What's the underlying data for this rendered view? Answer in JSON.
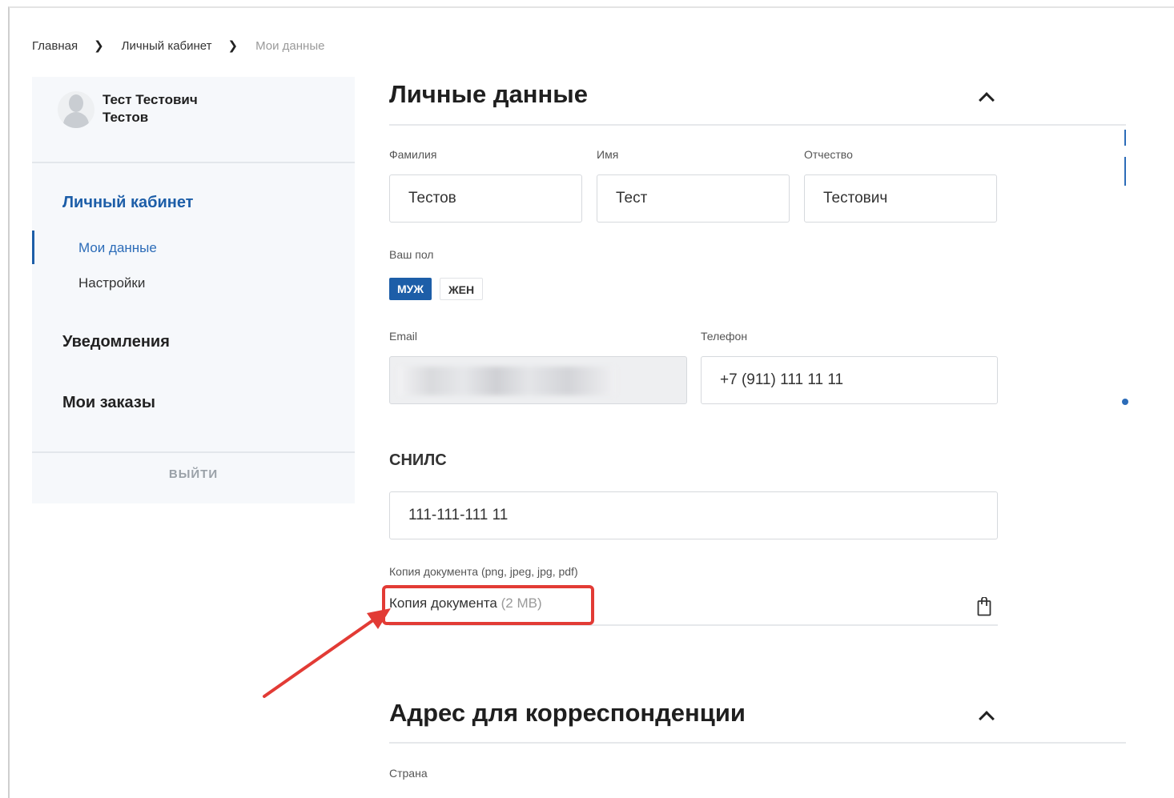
{
  "breadcrumb": {
    "items": [
      "Главная",
      "Личный кабинет",
      "Мои данные"
    ]
  },
  "sidebar": {
    "user_name_line1": "Тест Тестович",
    "user_name_line2": "Тестов",
    "section_cabinet": "Личный кабинет",
    "sub_my_data": "Мои данные",
    "sub_settings": "Настройки",
    "section_notifications": "Уведомления",
    "section_orders": "Мои заказы",
    "logout": "ВЫЙТИ"
  },
  "personal": {
    "title": "Личные данные",
    "surname_label": "Фамилия",
    "surname_value": "Тестов",
    "name_label": "Имя",
    "name_value": "Тест",
    "patronymic_label": "Отчество",
    "patronymic_value": "Тестович",
    "gender_label": "Ваш пол",
    "gender_male": "МУЖ",
    "gender_female": "ЖЕН",
    "gender_selected": "МУЖ",
    "email_label": "Email",
    "phone_label": "Телефон",
    "phone_value": "+7 (911) 111 11 11",
    "snils_title": "СНИЛС",
    "snils_value": "111-111-111 11",
    "doc_label": "Копия документа (png, jpeg, jpg, pdf)",
    "doc_name": "Копия документа",
    "doc_size": "(2 MB)"
  },
  "address": {
    "title": "Адрес для корреспонденции",
    "country_label": "Страна"
  },
  "colors": {
    "accent": "#1d5ea8",
    "annotation": "#e23b35"
  }
}
